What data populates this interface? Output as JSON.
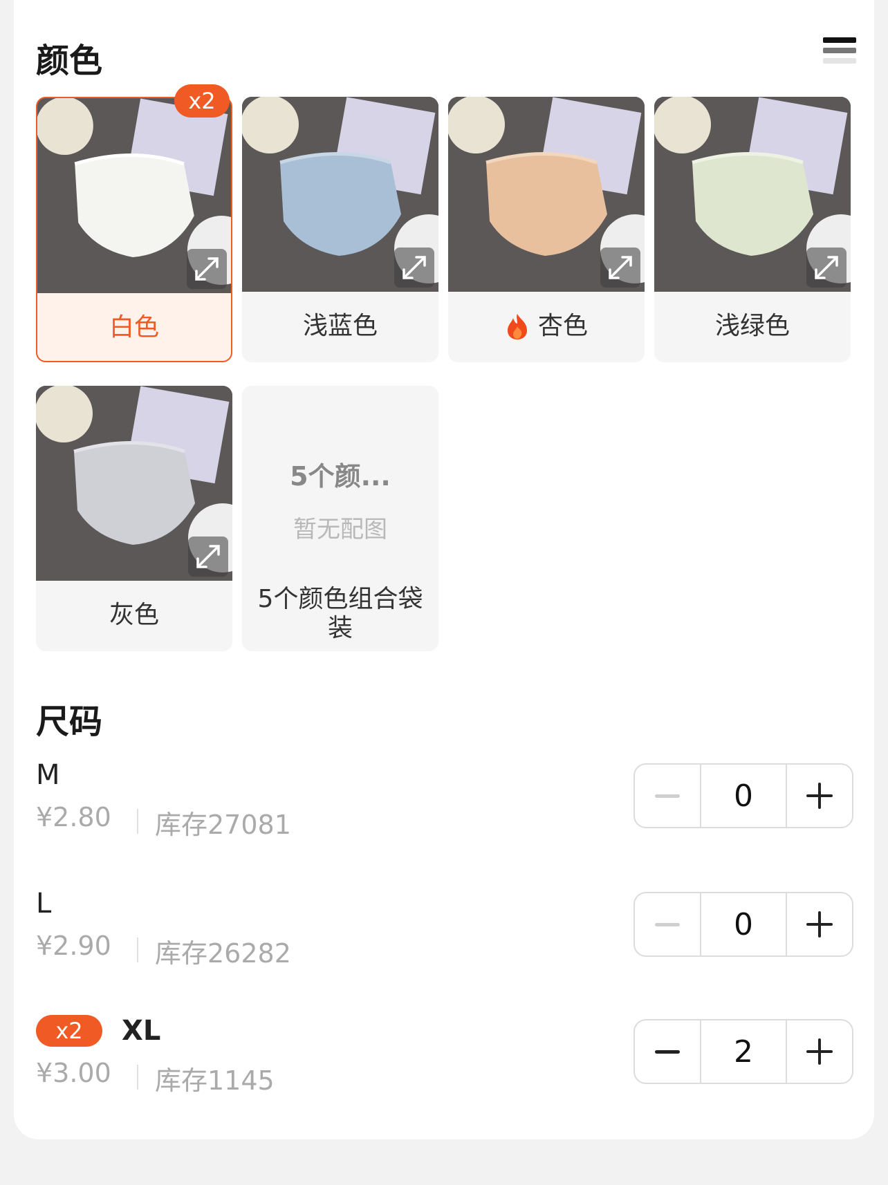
{
  "colors": {
    "title": "颜色",
    "accent": "#f05a24",
    "items": [
      {
        "label": "白色",
        "badge": "x2",
        "selected": true,
        "swatch": "#f4f4f0",
        "hot": false
      },
      {
        "label": "浅蓝色",
        "selected": false,
        "swatch": "#a9bfd6",
        "hot": false
      },
      {
        "label": "杏色",
        "selected": false,
        "swatch": "#e8c09e",
        "hot": true
      },
      {
        "label": "浅绿色",
        "selected": false,
        "swatch": "#dfe6cf",
        "hot": false
      },
      {
        "label": "灰色",
        "selected": false,
        "swatch": "#cfcfd6",
        "hot": false
      },
      {
        "label": "5个颜色组合袋装",
        "placeholder_title": "5个颜...",
        "placeholder_sub": "暂无配图",
        "selected": false
      }
    ]
  },
  "sizes": {
    "title": "尺码",
    "items": [
      {
        "name": "M",
        "price": "¥2.80",
        "stock": "库存27081",
        "qty": "0"
      },
      {
        "name": "L",
        "price": "¥2.90",
        "stock": "库存26282",
        "qty": "0"
      },
      {
        "name": "XL",
        "badge": "x2",
        "price": "¥3.00",
        "stock": "库存1145",
        "qty": "2"
      }
    ]
  }
}
